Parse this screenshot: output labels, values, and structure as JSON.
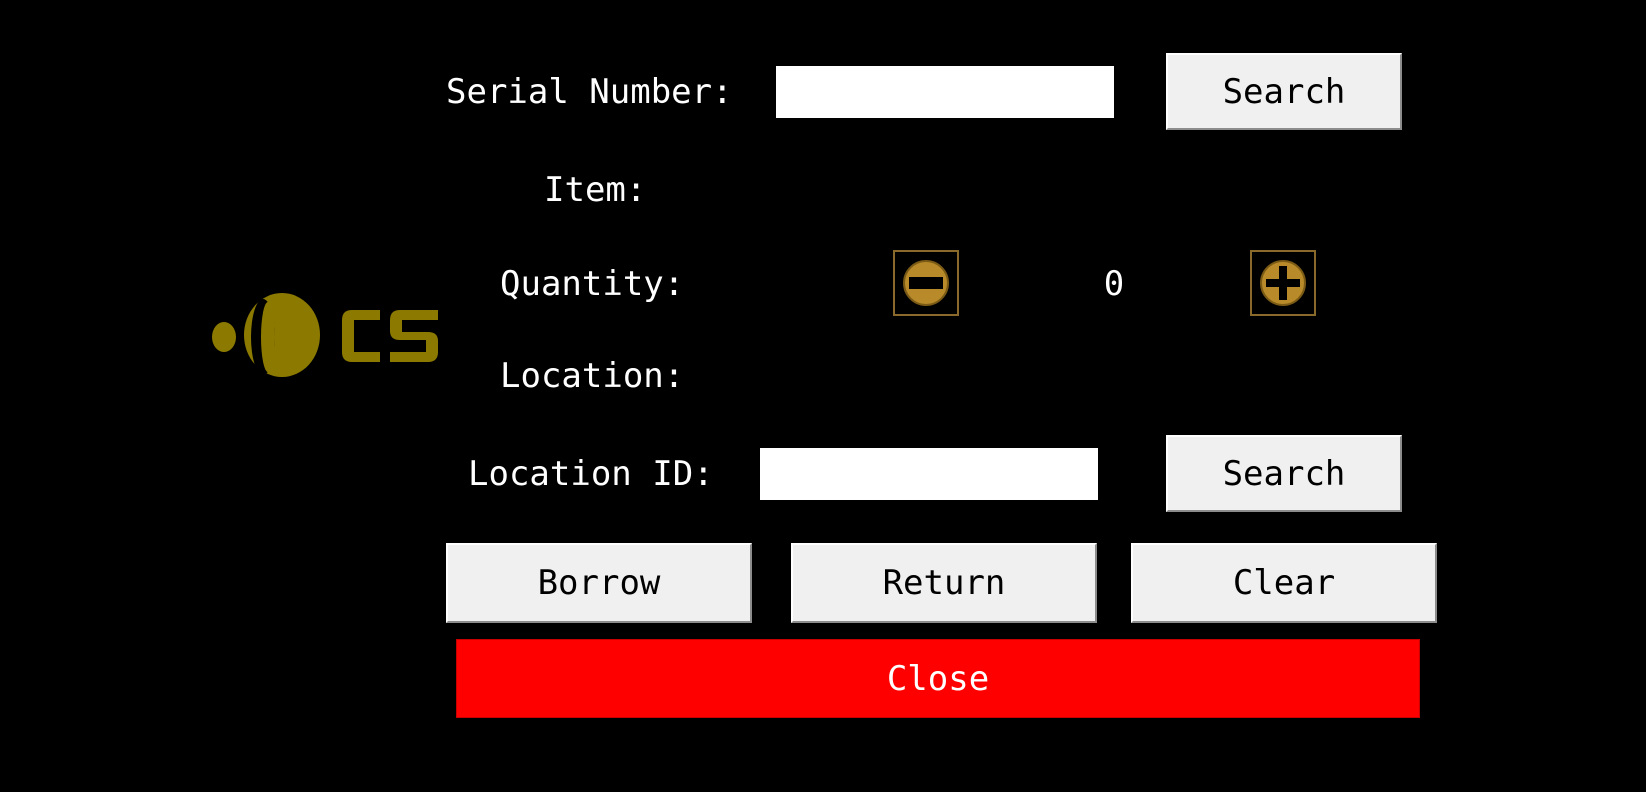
{
  "colors": {
    "background": "#000000",
    "accent_logo": "#8c7a00",
    "close_button": "#ff0000",
    "button_face": "#f0f0f0",
    "stepper_icon": "#b88a2a"
  },
  "logo": {
    "text": "CS",
    "icon": "cs-logo-icon"
  },
  "form": {
    "serial_label": "Serial Number:",
    "serial_value": "",
    "serial_search_label": "Search",
    "item_label": "Item:",
    "item_value": "",
    "quantity_label": "Quantity:",
    "quantity_value": "0",
    "decrement_icon": "minus-circle-icon",
    "increment_icon": "plus-circle-icon",
    "location_label": "Location:",
    "location_value": "",
    "location_id_label": "Location ID:",
    "location_id_value": "",
    "location_search_label": "Search"
  },
  "actions": {
    "borrow_label": "Borrow",
    "return_label": "Return",
    "clear_label": "Clear",
    "close_label": "Close"
  }
}
